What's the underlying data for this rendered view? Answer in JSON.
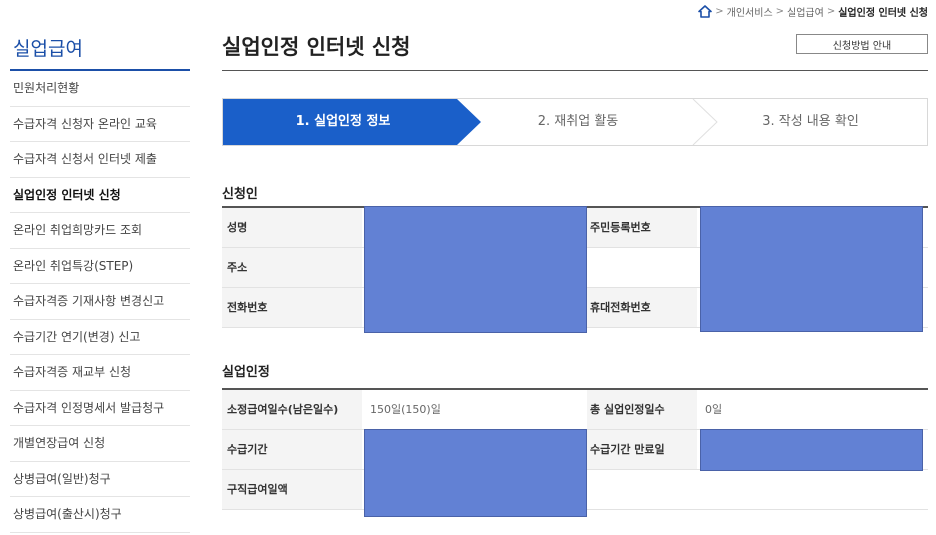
{
  "breadcrumb": {
    "items": [
      "개인서비스",
      "실업급여",
      "실업인정 인터넷 신청"
    ],
    "separator": ">"
  },
  "sidebar": {
    "title": "실업급여",
    "items": [
      {
        "label": "민원처리현황"
      },
      {
        "label": "수급자격 신청자 온라인 교육"
      },
      {
        "label": "수급자격 신청서 인터넷 제출"
      },
      {
        "label": "실업인정 인터넷 신청"
      },
      {
        "label": "온라인 취업희망카드 조회"
      },
      {
        "label": "온라인 취업특강(STEP)"
      },
      {
        "label": "수급자격증 기재사항 변경신고"
      },
      {
        "label": "수급기간 연기(변경) 신고"
      },
      {
        "label": "수급자격증 재교부 신청"
      },
      {
        "label": "수급자격 인정명세서 발급청구"
      },
      {
        "label": "개별연장급여 신청"
      },
      {
        "label": "상병급여(일반)청구"
      },
      {
        "label": "상병급여(출산시)청구"
      }
    ],
    "active_index": 3
  },
  "main": {
    "title": "실업인정 인터넷 신청",
    "guide_button": "신청방법 안내",
    "steps": [
      {
        "label": "1. 실업인정 정보",
        "active": true
      },
      {
        "label": "2. 재취업 활동",
        "active": false
      },
      {
        "label": "3. 작성 내용 확인",
        "active": false
      }
    ]
  },
  "applicant": {
    "title": "신청인",
    "name_label": "성명",
    "rrn_label": "주민등록번호",
    "address_label": "주소",
    "phone_label": "전화번호",
    "mobile_label": "휴대전화번호"
  },
  "recognition": {
    "title": "실업인정",
    "days_label": "소정급여일수(남은일수)",
    "days_value": "150일(150)일",
    "total_label": "총 실업인정일수",
    "total_value": "0일",
    "period_label": "수급기간",
    "expiry_label": "수급기간 만료일",
    "amount_label": "구직급여일액"
  },
  "colors": {
    "accent": "#1b4fa8",
    "step_active": "#1a5fc9",
    "redaction": "#6281d4"
  }
}
